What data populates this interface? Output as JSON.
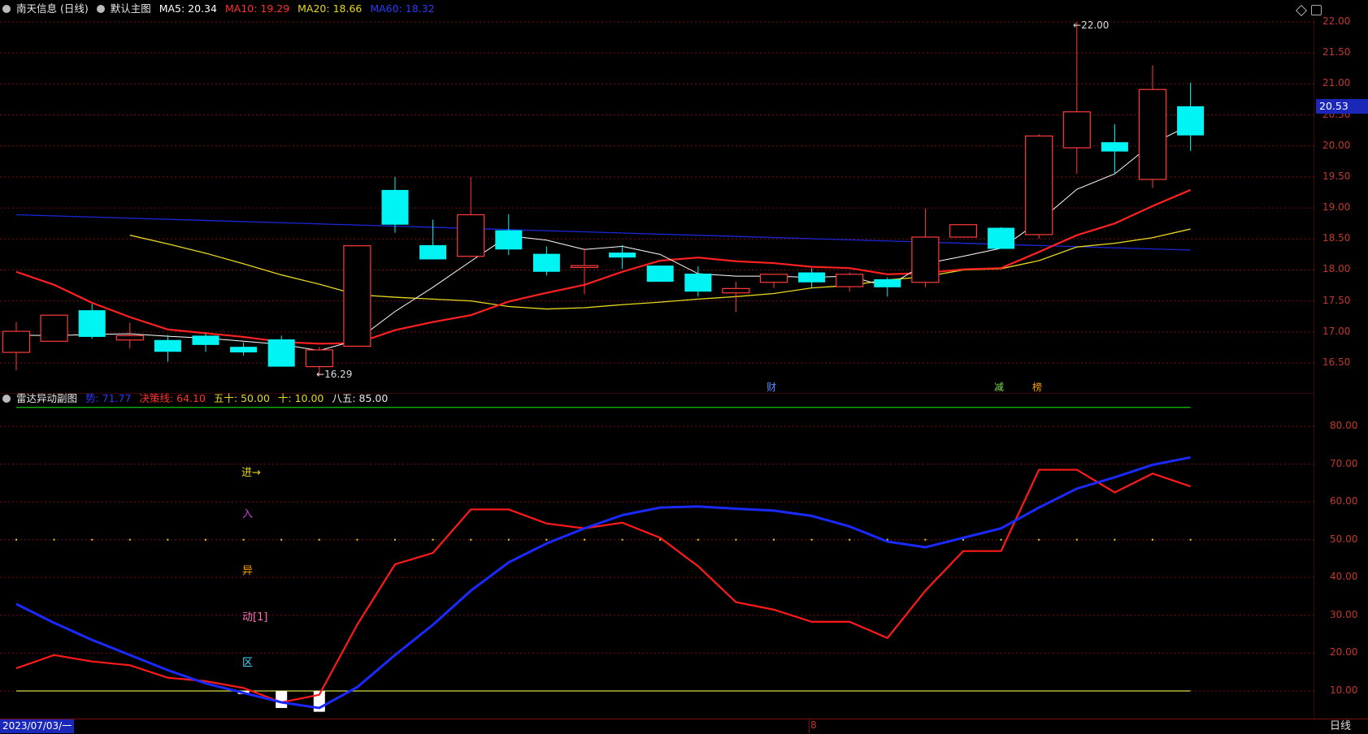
{
  "colors": {
    "up": "#ff3b3b",
    "down": "#00f4f4",
    "ma5": "#ffffff",
    "ma10": "#ff2020",
    "ma20": "#e6d81e",
    "ma60": "#1b27d9",
    "grid": "#7a0d0d",
    "axis_text": "#c0392b",
    "radar_blue": "#1a2aff",
    "radar_red": "#ff1a1a",
    "line85": "#13c613",
    "line10": "#d9d94a"
  },
  "main_header": {
    "stock": "南天信息 (日线)",
    "template": "默认主图",
    "ma5": "MA5: 20.34",
    "ma10": "MA10: 19.29",
    "ma20": "MA20: 18.66",
    "ma60": "MA60: 18.32"
  },
  "sub_header": {
    "title": "雷达异动副图",
    "v1": "势: 71.77",
    "v2": "决策线: 64.10",
    "v3": "五十: 50.00",
    "v4": "十: 10.00",
    "v5": "八五: 85.00"
  },
  "price_axis": [
    "22.00",
    "21.50",
    "21.00",
    "20.50",
    "20.00",
    "19.50",
    "19.00",
    "18.50",
    "18.00",
    "17.50",
    "17.00",
    "16.50"
  ],
  "current_price": "20.53",
  "sub_axis": [
    "80.00",
    "70.00",
    "60.00",
    "50.00",
    "40.00",
    "30.00",
    "20.00",
    "10.00"
  ],
  "annotations": {
    "high": "22.00",
    "low": "16.29",
    "cai": "财",
    "jian": "减",
    "bang": "榜",
    "month_marker": "8"
  },
  "side_labels": [
    "进→",
    "入",
    "异",
    "动[1]",
    "区"
  ],
  "bottom": {
    "date": "2023/07/03/一",
    "period": "日线"
  },
  "chart_data": [
    {
      "type": "candlestick",
      "title": "",
      "ylim": [
        16.2,
        22.2
      ],
      "candles": [
        {
          "o": 16.67,
          "h": 17.16,
          "l": 16.38,
          "c": 17.01
        },
        {
          "o": 16.85,
          "h": 17.27,
          "l": 16.85,
          "c": 17.27
        },
        {
          "o": 17.35,
          "h": 17.45,
          "l": 16.89,
          "c": 16.92
        },
        {
          "o": 16.87,
          "h": 17.15,
          "l": 16.73,
          "c": 16.94
        },
        {
          "o": 16.87,
          "h": 16.95,
          "l": 16.52,
          "c": 16.68
        },
        {
          "o": 16.94,
          "h": 16.98,
          "l": 16.68,
          "c": 16.79
        },
        {
          "o": 16.76,
          "h": 16.83,
          "l": 16.62,
          "c": 16.67
        },
        {
          "o": 16.88,
          "h": 16.94,
          "l": 16.44,
          "c": 16.44
        },
        {
          "o": 16.44,
          "h": 16.76,
          "l": 16.29,
          "c": 16.71
        },
        {
          "o": 16.77,
          "h": 18.39,
          "l": 16.77,
          "c": 18.39
        },
        {
          "o": 19.29,
          "h": 19.5,
          "l": 18.6,
          "c": 18.73
        },
        {
          "o": 18.4,
          "h": 18.81,
          "l": 18.17,
          "c": 18.17
        },
        {
          "o": 18.22,
          "h": 19.5,
          "l": 18.22,
          "c": 18.89
        },
        {
          "o": 18.64,
          "h": 18.9,
          "l": 18.24,
          "c": 18.33
        },
        {
          "o": 18.26,
          "h": 18.38,
          "l": 17.91,
          "c": 17.97
        },
        {
          "o": 18.04,
          "h": 18.35,
          "l": 17.61,
          "c": 18.07
        },
        {
          "o": 18.28,
          "h": 18.4,
          "l": 18.02,
          "c": 18.2
        },
        {
          "o": 18.07,
          "h": 18.07,
          "l": 17.81,
          "c": 17.81
        },
        {
          "o": 17.94,
          "h": 18.06,
          "l": 17.57,
          "c": 17.65
        },
        {
          "o": 17.63,
          "h": 17.81,
          "l": 17.32,
          "c": 17.7
        },
        {
          "o": 17.8,
          "h": 17.89,
          "l": 17.71,
          "c": 17.93
        },
        {
          "o": 17.96,
          "h": 18.03,
          "l": 17.71,
          "c": 17.8
        },
        {
          "o": 17.73,
          "h": 17.96,
          "l": 17.65,
          "c": 17.93
        },
        {
          "o": 17.85,
          "h": 17.88,
          "l": 17.57,
          "c": 17.72
        },
        {
          "o": 17.8,
          "h": 18.99,
          "l": 17.72,
          "c": 18.53
        },
        {
          "o": 18.53,
          "h": 18.72,
          "l": 18.53,
          "c": 18.73
        },
        {
          "o": 18.68,
          "h": 18.69,
          "l": 18.34,
          "c": 18.34
        },
        {
          "o": 18.57,
          "h": 20.19,
          "l": 18.5,
          "c": 20.16
        },
        {
          "o": 19.97,
          "h": 22.0,
          "l": 19.55,
          "c": 20.55
        },
        {
          "o": 20.06,
          "h": 20.35,
          "l": 19.55,
          "c": 19.91
        },
        {
          "o": 19.46,
          "h": 21.3,
          "l": 19.32,
          "c": 20.91
        },
        {
          "o": 20.64,
          "h": 21.02,
          "l": 19.92,
          "c": 20.17
        }
      ],
      "ma5": [
        16.95,
        16.94,
        16.96,
        16.97,
        16.93,
        16.9,
        16.85,
        16.8,
        16.7,
        16.87,
        17.33,
        17.72,
        18.14,
        18.55,
        18.48,
        18.33,
        18.38,
        18.25,
        17.94,
        17.9,
        17.9,
        17.88,
        17.9,
        17.73,
        18.1,
        18.22,
        18.35,
        18.78,
        19.3,
        19.55,
        20.04,
        20.34
      ],
      "ma10": [
        17.97,
        17.76,
        17.47,
        17.24,
        17.04,
        16.98,
        16.92,
        16.84,
        16.81,
        16.82,
        17.03,
        17.16,
        17.27,
        17.49,
        17.63,
        17.76,
        17.97,
        18.15,
        18.2,
        18.14,
        18.11,
        18.05,
        18.03,
        17.93,
        17.95,
        18.01,
        18.03,
        18.29,
        18.56,
        18.75,
        19.03,
        19.29
      ],
      "ma20": [
        18.56,
        18.42,
        18.27,
        18.1,
        17.92,
        17.77,
        17.6,
        17.56,
        17.53,
        17.5,
        17.41,
        17.37,
        17.39,
        17.44,
        17.48,
        17.53,
        17.57,
        17.62,
        17.71,
        17.75,
        17.84,
        17.89,
        18.0,
        18.02,
        18.15,
        18.37,
        18.43,
        18.52,
        18.66
      ],
      "ma20_start": 0,
      "ma60_from": 18.89,
      "ma60_to": 18.32
    },
    {
      "type": "line",
      "title": "",
      "ylim": [
        5,
        90
      ],
      "series": [
        {
          "name": "势",
          "values": [
            33.0,
            28.0,
            23.5,
            19.5,
            15.5,
            12.0,
            9.5,
            7.0,
            5.5,
            11.0,
            19.5,
            27.5,
            36.5,
            44.0,
            49.0,
            53.0,
            56.5,
            58.5,
            58.8,
            58.2,
            57.7,
            56.3,
            53.5,
            49.5,
            48.0,
            50.5,
            53.0,
            58.5,
            63.5,
            66.5,
            69.8,
            71.77
          ]
        },
        {
          "name": "决策线",
          "values": [
            16.0,
            19.5,
            17.8,
            16.8,
            13.5,
            12.6,
            10.8,
            7.0,
            9.0,
            27.5,
            43.5,
            46.5,
            58.0,
            58.0,
            54.3,
            53.0,
            54.5,
            50.5,
            43.0,
            33.5,
            31.5,
            28.3,
            28.3,
            24.0,
            36.5,
            47.0,
            47.0,
            68.5,
            68.5,
            62.5,
            67.5,
            64.1
          ]
        }
      ],
      "levels": [
        85,
        50,
        10
      ],
      "bars": [
        {
          "i": 6,
          "v": 10.0
        },
        {
          "i": 7,
          "v": 6.0
        },
        {
          "i": 8,
          "v": 5.0
        }
      ]
    }
  ]
}
